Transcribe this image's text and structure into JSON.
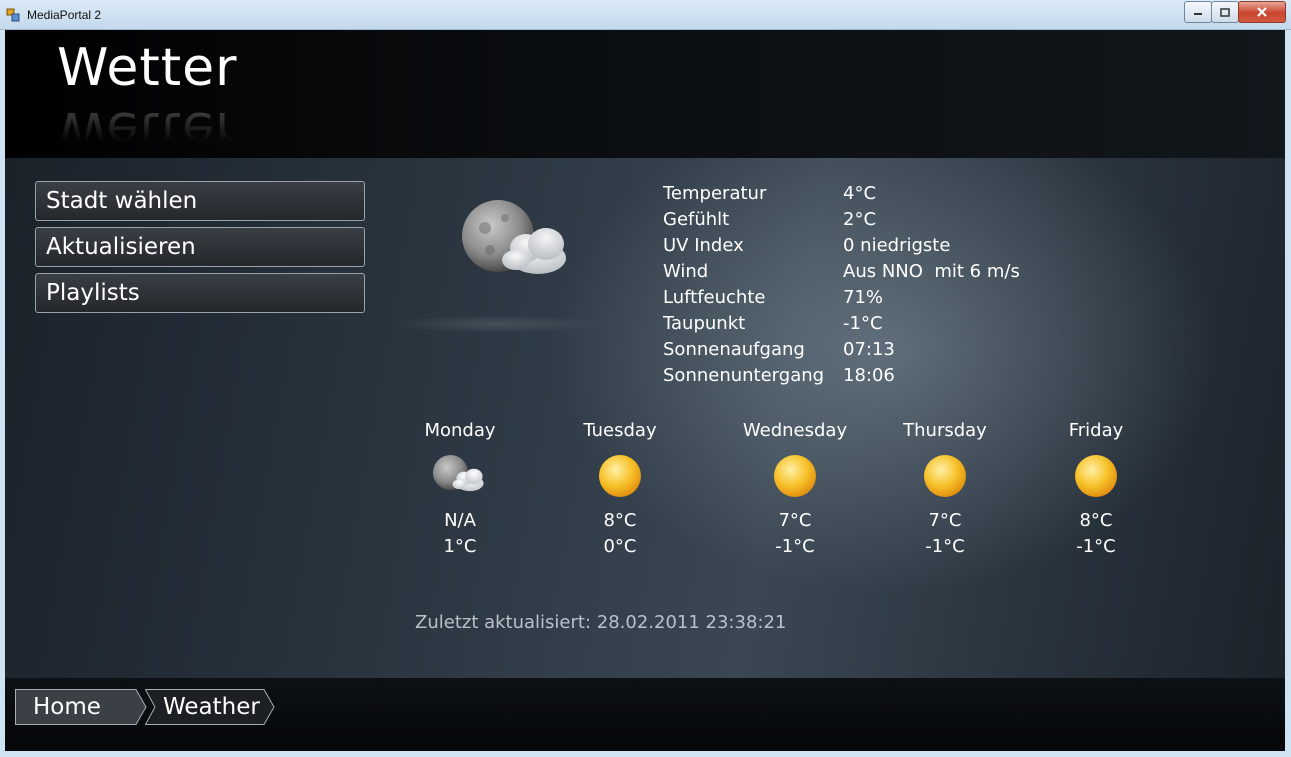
{
  "window": {
    "title": "MediaPortal 2"
  },
  "header": {
    "title": "Wetter"
  },
  "menu": {
    "items": [
      {
        "label": "Stadt wählen"
      },
      {
        "label": "Aktualisieren"
      },
      {
        "label": "Playlists"
      }
    ]
  },
  "current": {
    "icon": "moon-cloud-icon",
    "details": [
      {
        "label": "Temperatur",
        "value": "4°C"
      },
      {
        "label": "Gefühlt",
        "value": "2°C"
      },
      {
        "label": "UV Index",
        "value": "0 niedrigste"
      },
      {
        "label": "Wind",
        "value": "Aus NNO  mit 6 m/s"
      },
      {
        "label": "Luftfeuchte",
        "value": "71%"
      },
      {
        "label": "Taupunkt",
        "value": "-1°C"
      },
      {
        "label": "Sonnenaufgang",
        "value": "07:13"
      },
      {
        "label": "Sonnenuntergang",
        "value": "18:06"
      }
    ]
  },
  "forecast": [
    {
      "day": "Monday",
      "icon": "moon-cloud-icon",
      "high": "N/A",
      "low": "1°C"
    },
    {
      "day": "Tuesday",
      "icon": "sun-icon",
      "high": "8°C",
      "low": "0°C"
    },
    {
      "day": "Wednesday",
      "icon": "sun-icon",
      "high": "7°C",
      "low": "-1°C"
    },
    {
      "day": "Thursday",
      "icon": "sun-icon",
      "high": "7°C",
      "low": "-1°C"
    },
    {
      "day": "Friday",
      "icon": "sun-icon",
      "high": "8°C",
      "low": "-1°C"
    }
  ],
  "updated": "Zuletzt aktualisiert: 28.02.2011 23:38:21",
  "breadcrumb": [
    {
      "label": "Home"
    },
    {
      "label": "Weather"
    }
  ],
  "colors": {
    "background": "#1c242c",
    "text": "#ffffff",
    "muted": "#b9c2ca",
    "button_border": "#9aa3ab",
    "sun": "#f7b81e"
  }
}
